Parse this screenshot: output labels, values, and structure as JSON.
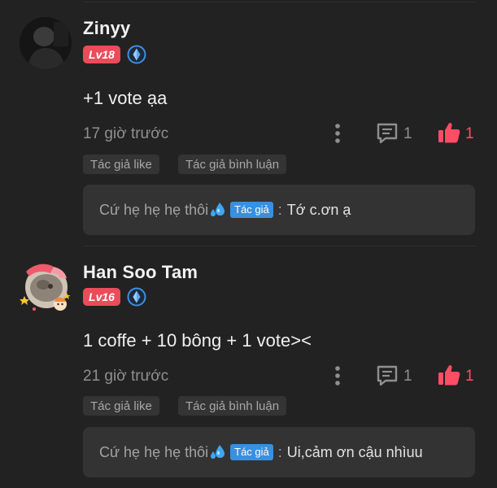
{
  "comments": [
    {
      "username": "Zinyy",
      "level": "Lv18",
      "content": "+1 vote ạa",
      "time": "17 giờ trước",
      "reply_count": "1",
      "like_count": "1",
      "tags": [
        "Tác giả like",
        "Tác giả bình luận"
      ],
      "reply": {
        "author": "Cứ hẹ hẹ hẹ thôi",
        "badge": "Tác giả",
        "separator": ":",
        "text": "Tớ c.ơn ạ"
      }
    },
    {
      "username": "Han Soo Tam",
      "level": "Lv16",
      "content": "1 coffe + 10 bông + 1 vote><",
      "time": "21 giờ trước",
      "reply_count": "1",
      "like_count": "1",
      "tags": [
        "Tác giả like",
        "Tác giả bình luận"
      ],
      "reply": {
        "author": "Cứ hẹ hẹ hẹ thôi",
        "badge": "Tác giả",
        "separator": ":",
        "text": "Ui,cảm ơn cậu nhìuu"
      }
    }
  ],
  "icons": {
    "more": "more-vertical-icon",
    "reply": "comment-icon",
    "like": "thumbs-up-icon",
    "rank": "rank-diamond-icon",
    "drop": "sweat-drops-emoji"
  },
  "colors": {
    "background": "#222222",
    "level_badge": "#ec4b5a",
    "like": "#ff4d66",
    "author_badge": "#3a8fde",
    "rank_ring": "#3d8fe0"
  }
}
